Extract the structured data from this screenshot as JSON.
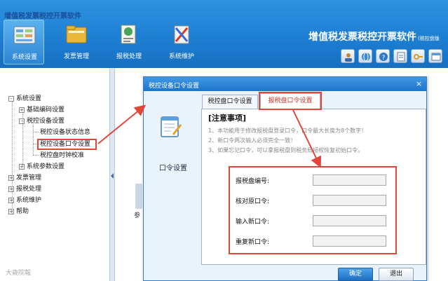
{
  "toolbar": {
    "items": [
      {
        "label": "系统设置",
        "icon": "settings-panel-icon",
        "active": true
      },
      {
        "label": "发票管理",
        "icon": "folder-icon",
        "active": false
      },
      {
        "label": "报税处理",
        "icon": "tax-report-icon",
        "active": false
      },
      {
        "label": "系统维护",
        "icon": "maintenance-tools-icon",
        "active": false
      }
    ],
    "app_title": "增值税发票税控开票软件",
    "app_subtitle": "(税控盘版",
    "small_buttons": [
      "user-icon",
      "globe-icon",
      "help-icon",
      "document-icon",
      "key-icon",
      "window-icon"
    ]
  },
  "tree": {
    "title": "增值税发票税控开票软件",
    "nodes": [
      {
        "label": "系统设置",
        "toggle": "-"
      },
      {
        "label": "基础编码设置",
        "toggle": "+"
      },
      {
        "label": "税控设备设置",
        "toggle": "-"
      },
      {
        "label": "税控设备状态信息"
      },
      {
        "label": "税控设备口令设置"
      },
      {
        "label": "税控盘时钟校准"
      },
      {
        "label": "系统参数设置",
        "toggle": "+"
      },
      {
        "label": "发票管理",
        "toggle": "+"
      },
      {
        "label": "报税处理",
        "toggle": "+"
      },
      {
        "label": "系统维护",
        "toggle": "+"
      },
      {
        "label": "帮助",
        "toggle": "+"
      }
    ]
  },
  "background": {
    "partial_label": "参"
  },
  "dialog": {
    "title": "税控设备口令设置",
    "close": "×",
    "side_label": "口令设置",
    "tabs": [
      {
        "label": "税控盘口令设置"
      },
      {
        "label": "报税盘口令设置"
      }
    ],
    "notice_title": "[注意事项]",
    "notices": [
      "1、本功能用于修改报税盘登录口令，口令最大长度为8个数字！",
      "2、新口令两次输入必须完全一致！",
      "3、如果忘记口令，可以拿报税盘到税务局授权恢复初始口令。"
    ],
    "fields": [
      {
        "label": "报税盘编号:",
        "value": ""
      },
      {
        "label": "核对原口令:",
        "value": ""
      },
      {
        "label": "输入新口令:",
        "value": ""
      },
      {
        "label": "重复新口令:",
        "value": ""
      }
    ],
    "ok_label": "确定",
    "exit_label": "退出"
  },
  "watermark": "大歲院報",
  "colors": {
    "toolbar_blue": "#1e7fd3",
    "annotation_red": "#e0463a",
    "tree_title": "#1a4f9a"
  }
}
